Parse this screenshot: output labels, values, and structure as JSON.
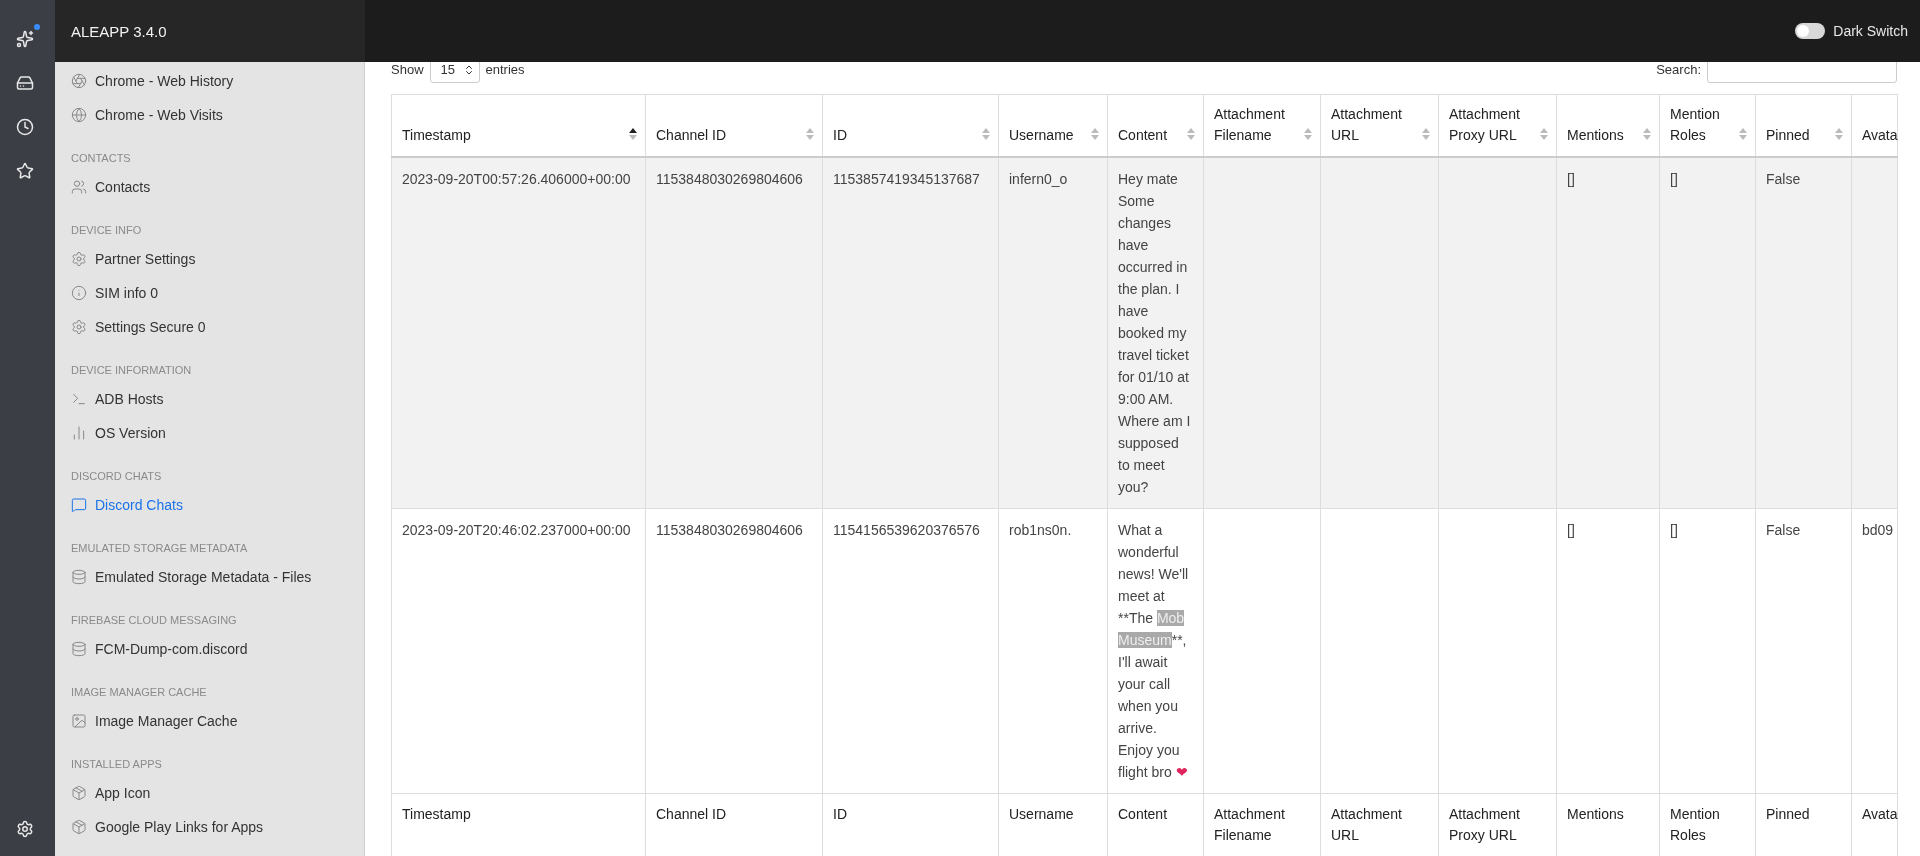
{
  "app": {
    "title": "ALEAPP 3.4.0",
    "dark_switch": {
      "label": "Dark Switch",
      "on": false
    }
  },
  "sidebar": {
    "groups": [
      {
        "items": [
          {
            "label": "Chrome - Web History",
            "selected": false
          },
          {
            "label": "Chrome - Web Visits",
            "selected": false
          }
        ]
      },
      {
        "title": "CONTACTS",
        "items": [
          {
            "label": "Contacts",
            "selected": false
          }
        ]
      },
      {
        "title": "DEVICE INFO",
        "items": [
          {
            "label": "Partner Settings",
            "selected": false
          },
          {
            "label": "SIM info 0",
            "selected": false
          },
          {
            "label": "Settings Secure 0",
            "selected": false
          }
        ]
      },
      {
        "title": "DEVICE INFORMATION",
        "items": [
          {
            "label": "ADB Hosts",
            "selected": false
          },
          {
            "label": "OS Version",
            "selected": false
          }
        ]
      },
      {
        "title": "DISCORD CHATS",
        "items": [
          {
            "label": "Discord Chats",
            "selected": true
          }
        ]
      },
      {
        "title": "EMULATED STORAGE METADATA",
        "items": [
          {
            "label": "Emulated Storage Metadata - Files",
            "selected": false
          }
        ]
      },
      {
        "title": "FIREBASE CLOUD MESSAGING",
        "items": [
          {
            "label": "FCM-Dump-com.discord",
            "selected": false
          }
        ]
      },
      {
        "title": "IMAGE MANAGER CACHE",
        "items": [
          {
            "label": "Image Manager Cache",
            "selected": false
          }
        ]
      },
      {
        "title": "INSTALLED APPS",
        "items": [
          {
            "label": "App Icon",
            "selected": false
          },
          {
            "label": "Google Play Links for Apps",
            "selected": false
          }
        ]
      }
    ]
  },
  "controls": {
    "show_label": "Show",
    "page_size": "15",
    "entries_label": "entries",
    "search_label": "Search:"
  },
  "table": {
    "columns": [
      {
        "label": "Timestamp",
        "sorted_ascending": true
      },
      {
        "label": "Channel ID",
        "sorted_ascending": false
      },
      {
        "label": "ID",
        "sorted_ascending": false
      },
      {
        "label": "Username",
        "sorted_ascending": false
      },
      {
        "label": "Content",
        "sorted_ascending": false
      },
      {
        "label": "Attachment Filename",
        "sorted_ascending": false
      },
      {
        "label": "Attachment URL",
        "sorted_ascending": false
      },
      {
        "label": "Attachment Proxy URL",
        "sorted_ascending": false
      },
      {
        "label": "Mentions",
        "sorted_ascending": false
      },
      {
        "label": "Mention Roles",
        "sorted_ascending": false
      },
      {
        "label": "Pinned",
        "sorted_ascending": false
      },
      {
        "label": "Avata"
      }
    ],
    "rows": [
      {
        "cells": [
          "2023-09-20T00:57:26.406000+00:00",
          "1153848030269804606",
          "1153857419345137687",
          "infern0_o",
          [
            {
              "text": "Hey mate Some changes have occurred in the plan. I have booked my travel ticket for 01/10 at 9:00 AM. Where am I supposed to meet you?"
            }
          ],
          "",
          "",
          "",
          "[]",
          "[]",
          "False",
          ""
        ]
      },
      {
        "cells": [
          "2023-09-20T20:46:02.237000+00:00",
          "1153848030269804606",
          "1154156539620376576",
          "rob1ns0n.",
          [
            {
              "text": "What a wonderful news! We'll meet at **The "
            },
            {
              "text": "Mob Museum",
              "highlighted": true
            },
            {
              "text": "**, I'll await your call when you arrive. Enjoy you flight bro "
            },
            {
              "text": "❤",
              "kind": "emoji"
            }
          ],
          "",
          "",
          "",
          "[]",
          "[]",
          "False",
          "bd09"
        ]
      }
    ],
    "footer": [
      "Timestamp",
      "Channel ID",
      "ID",
      "Username",
      "Content",
      "Attachment Filename",
      "Attachment URL",
      "Attachment Proxy URL",
      "Mentions",
      "Mention Roles",
      "Pinned",
      "Avata"
    ]
  }
}
